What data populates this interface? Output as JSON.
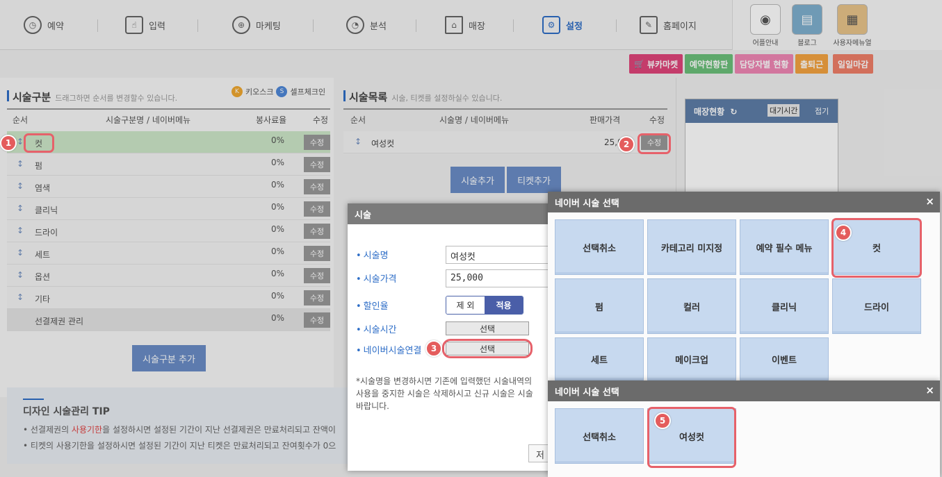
{
  "nav": {
    "items": [
      {
        "label": "예약",
        "icon": "clock-icon"
      },
      {
        "label": "입력",
        "icon": "hand-pointer-icon"
      },
      {
        "label": "마케팅",
        "icon": "globe-icon"
      },
      {
        "label": "분석",
        "icon": "pie-chart-icon"
      },
      {
        "label": "매장",
        "icon": "house-icon"
      },
      {
        "label": "설정",
        "icon": "gear-icon"
      },
      {
        "label": "홈페이지",
        "icon": "wrench-icon"
      }
    ],
    "active": "설정",
    "tools": [
      {
        "label": "어플안내",
        "icon": "camera-icon"
      },
      {
        "label": "블로그",
        "icon": "notebook-icon"
      },
      {
        "label": "사용자메뉴얼",
        "icon": "manual-icon"
      }
    ]
  },
  "actions": [
    {
      "label": "뷰카마켓",
      "color": "#e0457a",
      "icon": "cart-icon"
    },
    {
      "label": "예약현황판",
      "color": "#6cc07a"
    },
    {
      "label": "담당자별 현황",
      "color": "#f087b4"
    },
    {
      "label": "출퇴근",
      "color": "#f4a340"
    },
    {
      "label": "일일마감",
      "color": "#f07f68"
    }
  ],
  "category_panel": {
    "title": "시술구분",
    "subtitle": "드래그하면 순서를 변경할수 있습니다.",
    "kiosk_label": "키오스크",
    "kiosk_badge": "K",
    "selfcheck_label": "셀프체크인",
    "selfcheck_badge": "S",
    "headers": {
      "order": "순서",
      "name": "시술구분명 / 네이버메뉴",
      "rate": "봉사료율",
      "edit": "수정"
    },
    "rows": [
      {
        "name": "컷",
        "rate": "0%",
        "edit": "수정"
      },
      {
        "name": "펌",
        "rate": "0%",
        "edit": "수정"
      },
      {
        "name": "염색",
        "rate": "0%",
        "edit": "수정"
      },
      {
        "name": "클리닉",
        "rate": "0%",
        "edit": "수정"
      },
      {
        "name": "드라이",
        "rate": "0%",
        "edit": "수정"
      },
      {
        "name": "세트",
        "rate": "0%",
        "edit": "수정"
      },
      {
        "name": "옵션",
        "rate": "0%",
        "edit": "수정"
      },
      {
        "name": "기타",
        "rate": "0%",
        "edit": "수정"
      },
      {
        "name": "선결제권 관리",
        "rate": "0%",
        "edit": "수정"
      }
    ],
    "add_button": "시술구분 추가"
  },
  "tip": {
    "title": "디자인 시술관리 TIP",
    "line1_a": "선결제권의 ",
    "line1_b": "사용기한",
    "line1_c": "을 설정하시면 설정된 기간이 지난 선결제권은 만료처리되고 잔액이",
    "line2": "티켓의 사용기한을 설정하시면 설정된 기간이 지난 티켓은 만료처리되고 잔여횟수가 0으"
  },
  "service_panel": {
    "title": "시술목록",
    "subtitle": "시술, 티켓를 설정하실수 있습니다.",
    "headers": {
      "order": "순서",
      "name": "시술명 / 네이버메뉴",
      "price": "판매가격",
      "edit": "수정"
    },
    "rows": [
      {
        "name": "여성컷",
        "price": "25,0",
        "edit": "수정"
      }
    ],
    "add_service": "시술추가",
    "add_ticket": "티켓추가"
  },
  "store_panel": {
    "title": "매장현황",
    "wait": "대기시간",
    "fold": "접기"
  },
  "service_modal": {
    "title": "시술",
    "name_label": "시술명",
    "name_value": "여성컷",
    "price_label": "시술가격",
    "price_value": "25,000",
    "discount_label": "할인율",
    "discount_off": "제 외",
    "discount_on": "적용",
    "time_label": "시술시간",
    "time_button": "선택",
    "naver_label": "네이버시술연결",
    "naver_button": "선택",
    "note_1": "*시술명을 변경하시면 기존에 입력했던 시술내역의",
    "note_2": "사용을 중지한 시술은 삭제하시고 신규 시술은 시술",
    "note_3": "바랍니다.",
    "save_partial": "저"
  },
  "naver_modal_1": {
    "title": "네이버 시술 선택",
    "tiles": [
      "선택취소",
      "카테고리 미지정",
      "예약 필수 메뉴",
      "컷",
      "펌",
      "컬러",
      "클리닉",
      "드라이",
      "세트",
      "메이크업",
      "이벤트"
    ]
  },
  "naver_modal_2": {
    "title": "네이버 시술 선택",
    "tiles": [
      "선택취소",
      "여성컷"
    ]
  },
  "steps": [
    "1",
    "2",
    "3",
    "4",
    "5"
  ],
  "close_glyph": "×"
}
